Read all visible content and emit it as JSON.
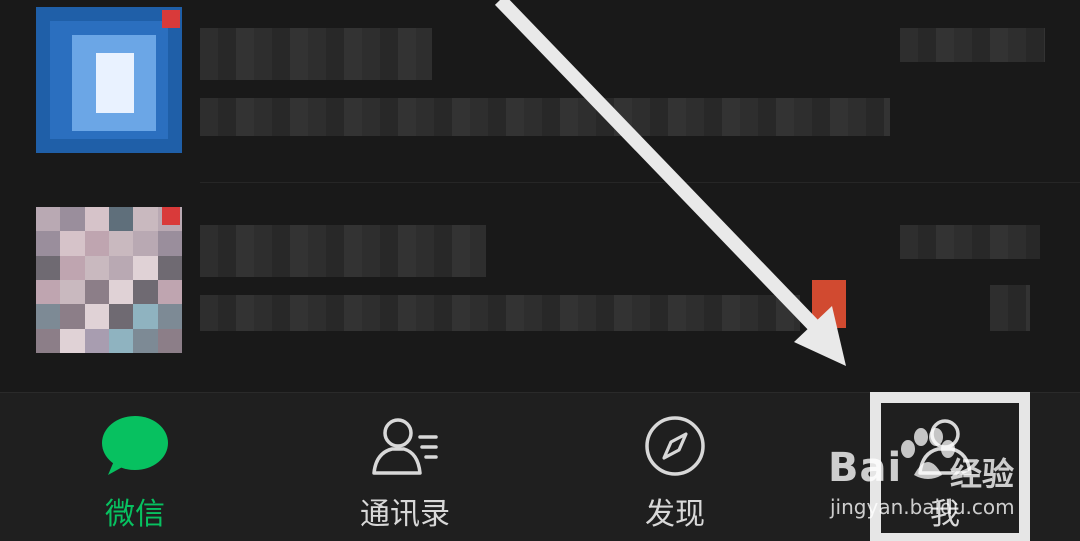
{
  "tabs": [
    {
      "key": "chats",
      "label": "微信",
      "icon": "chat-bubble-icon",
      "active": true
    },
    {
      "key": "contacts",
      "label": "通讯录",
      "icon": "contacts-icon",
      "active": false
    },
    {
      "key": "discover",
      "label": "发现",
      "icon": "compass-icon",
      "active": false
    },
    {
      "key": "me",
      "label": "我",
      "icon": "profile-icon",
      "active": false
    }
  ],
  "colors": {
    "accent": "#07c160",
    "background": "#191919",
    "tabbar": "#1f1f1f",
    "badge": "#d93a3a",
    "highlight": "#e6e6e6"
  },
  "watermark": {
    "brand_latin": "Bai",
    "brand_cn": "经验",
    "url": "jingyan.baidu.com"
  },
  "annotation": {
    "type": "arrow",
    "target": "tab-me"
  }
}
